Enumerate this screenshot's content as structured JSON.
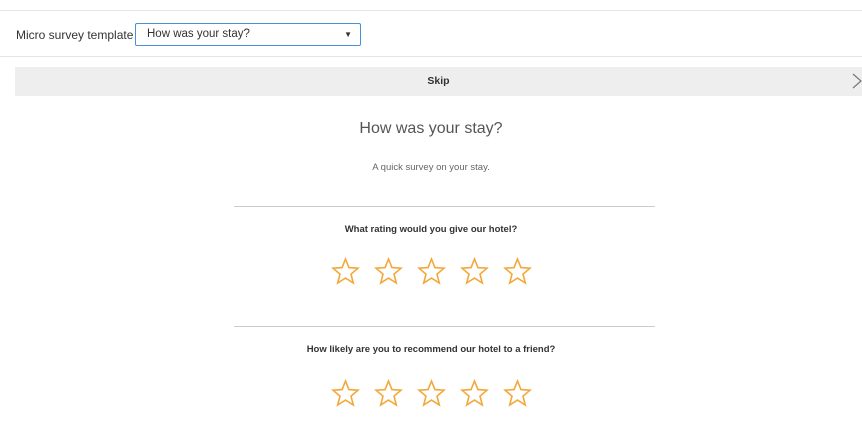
{
  "template_picker": {
    "label": "Micro survey template",
    "selected": "How was your stay?"
  },
  "skip": {
    "label": "Skip"
  },
  "survey": {
    "title": "How was your stay?",
    "subtitle": "A quick survey on your stay.",
    "questions": [
      {
        "text": "What rating would you give our hotel?",
        "rating": 0,
        "max": 5
      },
      {
        "text": "How likely are you to recommend our hotel to a friend?",
        "rating": 0,
        "max": 5
      }
    ]
  },
  "colors": {
    "star": "#f2a83a",
    "select_border": "#4a90d9",
    "skip_bar": "#eeeeee"
  },
  "icons": {
    "select_caret": "chevron-down-icon",
    "next": "chevron-right-icon",
    "rating": "star-outline-icon"
  }
}
